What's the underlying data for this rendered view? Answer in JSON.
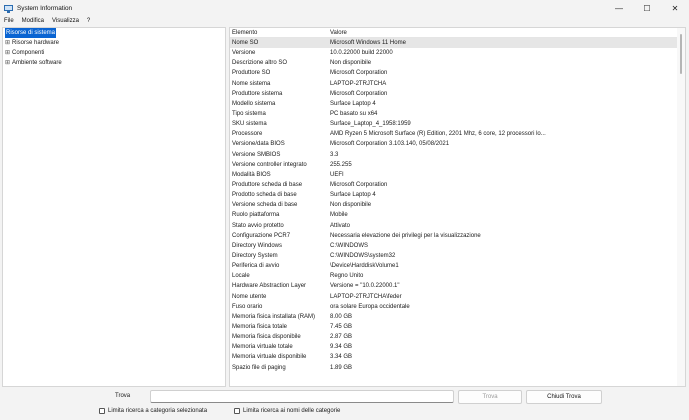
{
  "window": {
    "title": "System Information",
    "controls": {
      "minimize": "—",
      "maximize": "☐",
      "close": "✕"
    }
  },
  "menu": [
    "File",
    "Modifica",
    "Visualizza",
    "?"
  ],
  "tree": [
    {
      "label": "Risorse di sistema",
      "expander": "",
      "selected": true
    },
    {
      "label": "Risorse hardware",
      "expander": "⊞",
      "selected": false
    },
    {
      "label": "Componenti",
      "expander": "⊞",
      "selected": false
    },
    {
      "label": "Ambiente software",
      "expander": "⊞",
      "selected": false
    }
  ],
  "grid": {
    "headers": {
      "item": "Elemento",
      "value": "Valore"
    },
    "rows": [
      {
        "item": "Nome SO",
        "value": "Microsoft Windows 11 Home",
        "selected": true
      },
      {
        "item": "Versione",
        "value": "10.0.22000 build 22000"
      },
      {
        "item": "Descrizione altro SO",
        "value": "Non disponibile"
      },
      {
        "item": "Produttore SO",
        "value": "Microsoft Corporation"
      },
      {
        "item": "Nome sistema",
        "value": "LAPTOP-2TRJTCHA"
      },
      {
        "item": "Produttore sistema",
        "value": "Microsoft Corporation"
      },
      {
        "item": "Modello sistema",
        "value": "Surface Laptop 4"
      },
      {
        "item": "Tipo sistema",
        "value": "PC basato su x64"
      },
      {
        "item": "SKU sistema",
        "value": "Surface_Laptop_4_1958:1959"
      },
      {
        "item": "Processore",
        "value": "AMD Ryzen 5 Microsoft Surface (R) Edition, 2201 Mhz, 6 core, 12 processori lo..."
      },
      {
        "item": "Versione/data BIOS",
        "value": "Microsoft Corporation 3.103.140, 05/08/2021"
      },
      {
        "item": "Versione SMBIOS",
        "value": "3.3"
      },
      {
        "item": "Versione controller integrato",
        "value": "255.255"
      },
      {
        "item": "Modalità BIOS",
        "value": "UEFI"
      },
      {
        "item": "Produttore scheda di base",
        "value": "Microsoft Corporation"
      },
      {
        "item": "Prodotto scheda di base",
        "value": "Surface Laptop 4"
      },
      {
        "item": "Versione scheda di base",
        "value": "Non disponibile"
      },
      {
        "item": "Ruolo piattaforma",
        "value": "Mobile"
      },
      {
        "item": "Stato avvio protetto",
        "value": "Attivato"
      },
      {
        "item": "Configurazione PCR7",
        "value": "Necessaria elevazione dei privilegi per la visualizzazione"
      },
      {
        "item": "Directory Windows",
        "value": "C:\\WINDOWS"
      },
      {
        "item": "Directory System",
        "value": "C:\\WINDOWS\\system32"
      },
      {
        "item": "Periferica di avvio",
        "value": "\\Device\\HarddiskVolume1"
      },
      {
        "item": "Locale",
        "value": "Regno Unito"
      },
      {
        "item": "Hardware Abstraction Layer",
        "value": "Versione = \"10.0.22000.1\""
      },
      {
        "item": "Nome utente",
        "value": "LAPTOP-2TRJTCHA\\feder"
      },
      {
        "item": "Fuso orario",
        "value": "ora solare Europa occidentale"
      },
      {
        "item": "Memoria fisica installata (RAM)",
        "value": "8.00 GB"
      },
      {
        "item": "Memoria fisica totale",
        "value": "7.45 GB"
      },
      {
        "item": "Memoria fisica disponibile",
        "value": "2.87 GB"
      },
      {
        "item": "Memoria virtuale totale",
        "value": "9.34 GB"
      },
      {
        "item": "Memoria virtuale disponibile",
        "value": "3.34 GB"
      },
      {
        "item": "Spazio file di paging",
        "value": "1.89 GB"
      }
    ]
  },
  "search": {
    "label": "Trova",
    "value": "",
    "find_button": "Trova",
    "close_find_button": "Chiudi Trova",
    "option_selected_category": "Limita ricerca a categoria selezionata",
    "option_category_names": "Limita ricerca ai nomi delle categorie"
  }
}
